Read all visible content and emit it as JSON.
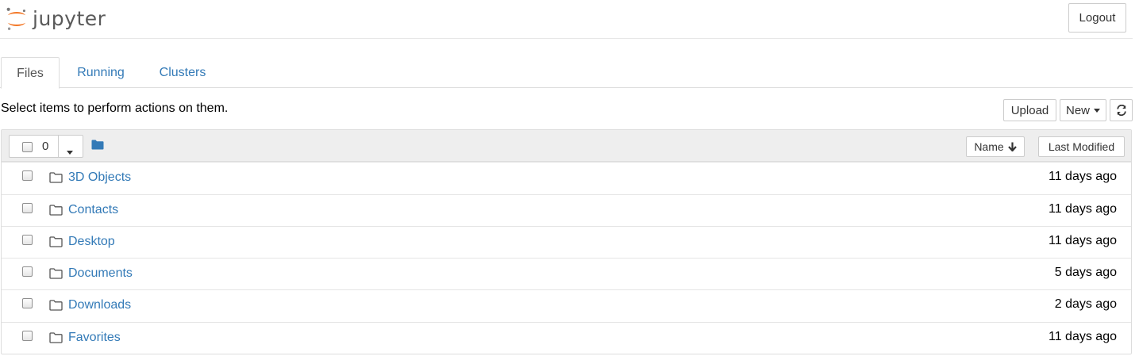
{
  "header": {
    "logo_text": "jupyter",
    "logout_label": "Logout"
  },
  "tabs": [
    {
      "label": "Files",
      "active": true
    },
    {
      "label": "Running",
      "active": false
    },
    {
      "label": "Clusters",
      "active": false
    }
  ],
  "toolbar": {
    "hint": "Select items to perform actions on them.",
    "upload_label": "Upload",
    "new_label": "New",
    "refresh_icon": "refresh-icon"
  },
  "list_header": {
    "selected_count": "0",
    "name_sort_label": "Name",
    "name_sort_icon": "arrow-down-icon",
    "last_modified_label": "Last Modified"
  },
  "items": [
    {
      "name": "3D Objects",
      "modified": "11 days ago",
      "icon": "folder-icon"
    },
    {
      "name": "Contacts",
      "modified": "11 days ago",
      "icon": "folder-icon"
    },
    {
      "name": "Desktop",
      "modified": "11 days ago",
      "icon": "folder-icon"
    },
    {
      "name": "Documents",
      "modified": "5 days ago",
      "icon": "folder-icon"
    },
    {
      "name": "Downloads",
      "modified": "2 days ago",
      "icon": "folder-icon"
    },
    {
      "name": "Favorites",
      "modified": "11 days ago",
      "icon": "folder-icon"
    }
  ],
  "colors": {
    "link": "#337ab7",
    "logo_orange": "#f37726",
    "header_bg": "#eeeeee"
  }
}
